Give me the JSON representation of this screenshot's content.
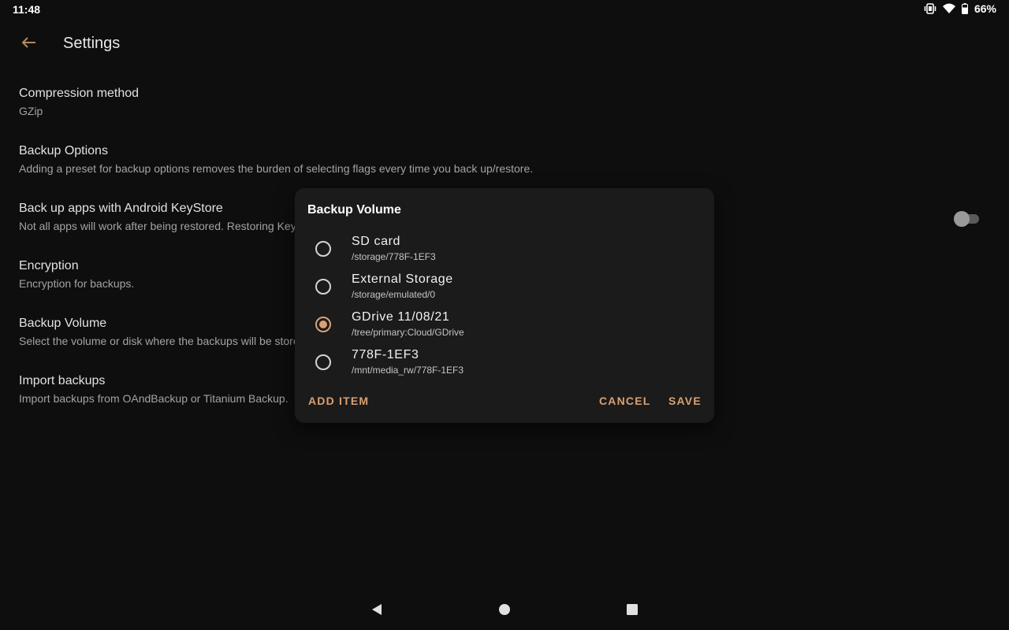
{
  "status_bar": {
    "time": "11:48",
    "battery": "66%",
    "icons": [
      "vibrate-icon",
      "wifi-icon",
      "battery-icon"
    ]
  },
  "toolbar": {
    "title": "Settings",
    "back_icon": "arrow-back-icon"
  },
  "settings": [
    {
      "title": "Compression method",
      "summary": "GZip"
    },
    {
      "title": "Backup Options",
      "summary": "Adding a preset for backup options removes the burden of selecting flags every time you back up/restore."
    },
    {
      "title": "Back up apps with Android KeyStore",
      "summary": "Not all apps will work after being restored. Restoring Key",
      "toggle_on": false
    },
    {
      "title": "Encryption",
      "summary": "Encryption for backups."
    },
    {
      "title": "Backup Volume",
      "summary": "Select the volume or disk where the backups will be store"
    },
    {
      "title": "Import backups",
      "summary": "Import backups from OAndBackup or Titanium Backup."
    }
  ],
  "dialog": {
    "title": "Backup Volume",
    "options": [
      {
        "name": "SD card",
        "path": "/storage/778F-1EF3",
        "selected": false
      },
      {
        "name": "External Storage",
        "path": "/storage/emulated/0",
        "selected": false
      },
      {
        "name": "GDrive 11/08/21",
        "path": "/tree/primary:Cloud/GDrive",
        "selected": true
      },
      {
        "name": "778F-1EF3",
        "path": "/mnt/media_rw/778F-1EF3",
        "selected": false
      }
    ],
    "add_item_label": "ADD ITEM",
    "cancel_label": "CANCEL",
    "save_label": "SAVE"
  },
  "colors": {
    "background": "#0e0e0e",
    "dialog": "#1b1b1b",
    "accent": "#d9a172"
  }
}
